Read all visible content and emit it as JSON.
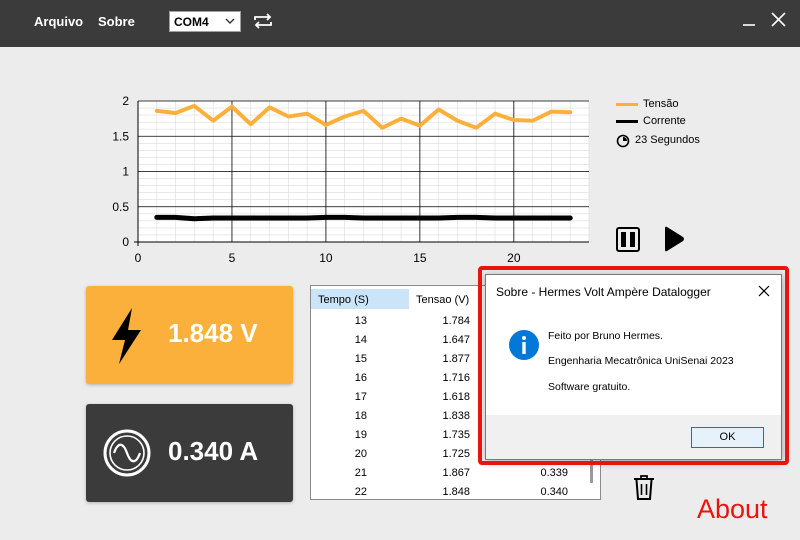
{
  "menu": {
    "file": "Arquivo",
    "about": "Sobre"
  },
  "port": {
    "selected": "COM4"
  },
  "colors": {
    "topbar": "#3b3b3b",
    "voltage": "#fbb03b",
    "current": "#000000",
    "current_card": "#3b3b3b",
    "highlight": "#e8140e",
    "info": "#0078d7"
  },
  "icons": [
    "refresh-icon",
    "minimize-icon",
    "close-icon",
    "timer-icon",
    "pause-icon",
    "play-icon",
    "lightning-icon",
    "sine-wave-icon",
    "trash-icon",
    "info-icon"
  ],
  "legend": {
    "voltage": "Tensão",
    "current": "Corrente",
    "timer": "23 Segundos"
  },
  "chart_data": {
    "type": "line",
    "x": [
      1,
      2,
      3,
      4,
      5,
      6,
      7,
      8,
      9,
      10,
      11,
      12,
      13,
      14,
      15,
      16,
      17,
      18,
      19,
      20,
      21,
      22,
      23
    ],
    "series": [
      {
        "name": "Tensão",
        "color": "#fbb03b",
        "values": [
          1.86,
          1.83,
          1.93,
          1.72,
          1.92,
          1.67,
          1.91,
          1.78,
          1.82,
          1.66,
          1.78,
          1.86,
          1.62,
          1.75,
          1.65,
          1.88,
          1.72,
          1.62,
          1.82,
          1.73,
          1.72,
          1.85,
          1.84
        ]
      },
      {
        "name": "Corrente",
        "color": "#000000",
        "values": [
          0.35,
          0.35,
          0.33,
          0.34,
          0.34,
          0.34,
          0.34,
          0.34,
          0.34,
          0.35,
          0.35,
          0.34,
          0.34,
          0.34,
          0.34,
          0.34,
          0.35,
          0.35,
          0.34,
          0.34,
          0.34,
          0.34,
          0.34
        ]
      }
    ],
    "xlim": [
      0,
      24
    ],
    "ylim": [
      0,
      2
    ],
    "xticks": [
      "0",
      "5",
      "10",
      "15",
      "20"
    ],
    "yticks": [
      "0",
      "0.5",
      "1",
      "1.5",
      "2"
    ],
    "grid": true
  },
  "voltage_card": {
    "value": "1.848 V"
  },
  "current_card": {
    "value": "0.340 A"
  },
  "table": {
    "headers": [
      "Tempo (S)",
      "Tensao (V)"
    ],
    "rows": [
      [
        "13",
        "1.784",
        ""
      ],
      [
        "14",
        "1.647",
        ""
      ],
      [
        "15",
        "1.877",
        ""
      ],
      [
        "16",
        "1.716",
        ""
      ],
      [
        "17",
        "1.618",
        ""
      ],
      [
        "18",
        "1.838",
        ""
      ],
      [
        "19",
        "1.735",
        ""
      ],
      [
        "20",
        "1.725",
        ""
      ],
      [
        "21",
        "1.867",
        "0.339"
      ],
      [
        "22",
        "1.848",
        "0.340"
      ]
    ]
  },
  "dialog": {
    "title": "Sobre - Hermes Volt Ampère Datalogger",
    "lines": [
      "Feito por Bruno Hermes.",
      "Engenharia Mecatrônica UniSenai 2023",
      "Software gratuito."
    ],
    "ok": "OK"
  },
  "annotation": "About"
}
